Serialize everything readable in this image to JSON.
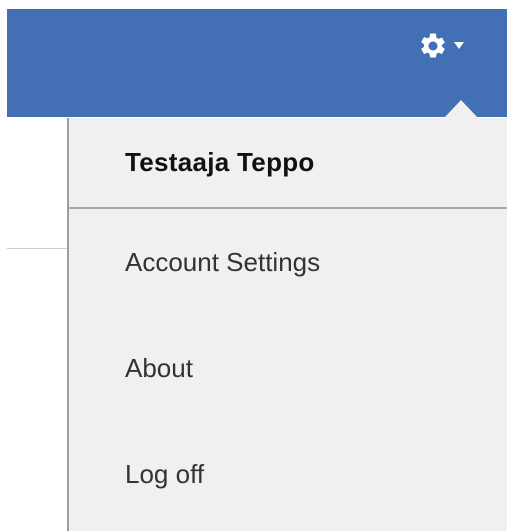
{
  "header": {
    "settings_icon": "gear-icon",
    "dropdown_indicator_icon": "chevron-down-icon",
    "color": "#4370b4"
  },
  "user_menu": {
    "user_name": "Testaaja Teppo",
    "items": [
      {
        "label": "Account Settings"
      },
      {
        "label": "About"
      },
      {
        "label": "Log off"
      }
    ],
    "background_color": "#f0f0f0"
  }
}
